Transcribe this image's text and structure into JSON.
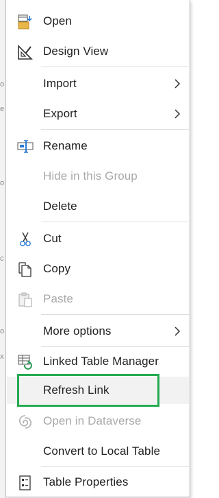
{
  "menu": {
    "items": [
      {
        "label": "Open",
        "icon": "open-icon",
        "disabled": false,
        "submenu": false
      },
      {
        "label": "Design View",
        "icon": "design-view-icon",
        "disabled": false,
        "submenu": false
      },
      {
        "label": "Import",
        "icon": "",
        "disabled": false,
        "submenu": true
      },
      {
        "label": "Export",
        "icon": "",
        "disabled": false,
        "submenu": true
      },
      {
        "label": "Rename",
        "icon": "rename-icon",
        "disabled": false,
        "submenu": false
      },
      {
        "label": "Hide in this Group",
        "icon": "",
        "disabled": true,
        "submenu": false
      },
      {
        "label": "Delete",
        "icon": "",
        "disabled": false,
        "submenu": false
      },
      {
        "label": "Cut",
        "icon": "cut-icon",
        "disabled": false,
        "submenu": false
      },
      {
        "label": "Copy",
        "icon": "copy-icon",
        "disabled": false,
        "submenu": false
      },
      {
        "label": "Paste",
        "icon": "paste-icon",
        "disabled": true,
        "submenu": false
      },
      {
        "label": "More options",
        "icon": "",
        "disabled": false,
        "submenu": true
      },
      {
        "label": "Linked Table Manager",
        "icon": "linked-table-manager-icon",
        "disabled": false,
        "submenu": false
      },
      {
        "label": "Refresh Link",
        "icon": "",
        "disabled": false,
        "submenu": false
      },
      {
        "label": "Open in Dataverse",
        "icon": "dataverse-icon",
        "disabled": true,
        "submenu": false
      },
      {
        "label": "Convert to Local Table",
        "icon": "",
        "disabled": false,
        "submenu": false
      },
      {
        "label": "Table Properties",
        "icon": "table-properties-icon",
        "disabled": false,
        "submenu": false
      }
    ]
  },
  "colors": {
    "highlight_border": "#22a94f",
    "disabled_text": "#a9a9a9",
    "text": "#1f1f1f"
  }
}
